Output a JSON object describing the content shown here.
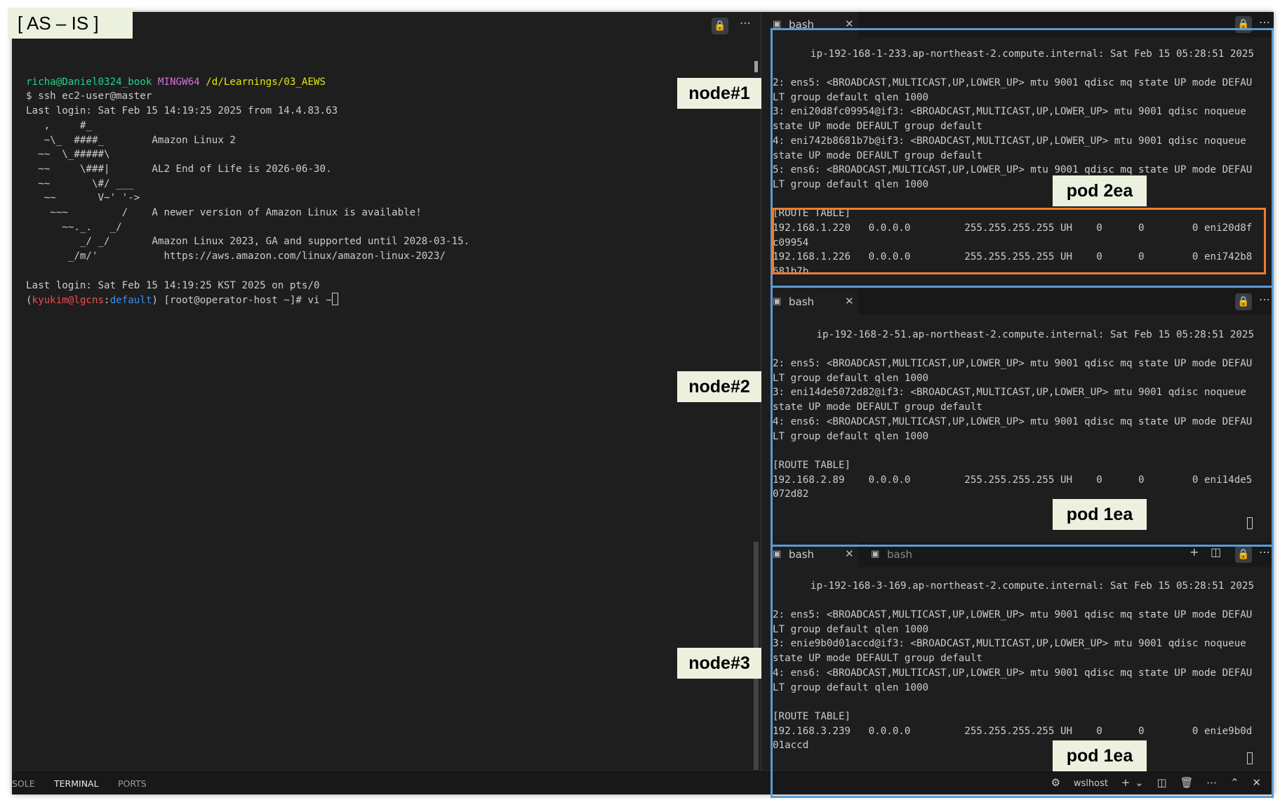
{
  "annotation": {
    "as_is_label": "[ AS – IS ]",
    "node1_label": "node#1",
    "node2_label": "node#2",
    "node3_label": "node#3",
    "pod_node1": "pod 2ea",
    "pod_node2": "pod 1ea",
    "pod_node3": "pod 1ea"
  },
  "left_terminal": {
    "prompt_user": "richa@Daniel0324_book",
    "prompt_env": "MINGW64",
    "prompt_path": "/d/Learnings/03_AEWS",
    "cmd_line": "$ ssh ec2-user@master",
    "last_login_1": "Last login: Sat Feb 15 14:19:25 2025 from 14.4.83.63",
    "banner": [
      "   ,     #_",
      "   ~\\_  ####_        Amazon Linux 2",
      "  ~~  \\_#####\\",
      "  ~~     \\###|       AL2 End of Life is 2026-06-30.",
      "  ~~       \\#/ ___",
      "   ~~       V~' '->",
      "    ~~~         /    A newer version of Amazon Linux is available!",
      "      ~~._.   _/",
      "         _/ _/       Amazon Linux 2023, GA and supported until 2028-03-15.",
      "       _/m/'           https://aws.amazon.com/linux/amazon-linux-2023/"
    ],
    "last_login_2": "Last login: Sat Feb 15 14:19:25 KST 2025 on pts/0",
    "ps1_open": "(",
    "ps1_user": "kyukim@lgcns",
    "ps1_colon": ":",
    "ps1_ctx": "default",
    "ps1_rest": ") [root@operator-host ~]# vi ~"
  },
  "pane1": {
    "tab_label": "bash",
    "header": "ip-192-168-1-233.ap-northeast-2.compute.internal: Sat Feb 15 05:28:51 2025",
    "lines": [
      "2: ens5: <BROADCAST,MULTICAST,UP,LOWER_UP> mtu 9001 qdisc mq state UP mode DEFAU",
      "LT group default qlen 1000",
      "3: eni20d8fc09954@if3: <BROADCAST,MULTICAST,UP,LOWER_UP> mtu 9001 qdisc noqueue",
      "state UP mode DEFAULT group default",
      "4: eni742b8681b7b@if3: <BROADCAST,MULTICAST,UP,LOWER_UP> mtu 9001 qdisc noqueue",
      "state UP mode DEFAULT group default",
      "5: ens6: <BROADCAST,MULTICAST,UP,LOWER_UP> mtu 9001 qdisc mq state UP mode DEFAU",
      "LT group default qlen 1000",
      "",
      "[ROUTE TABLE]",
      "192.168.1.220   0.0.0.0         255.255.255.255 UH    0      0        0 eni20d8f",
      "c09954",
      "192.168.1.226   0.0.0.0         255.255.255.255 UH    0      0        0 eni742b8",
      "681b7b"
    ]
  },
  "pane2": {
    "tab_label": "bash",
    "header": "ip-192-168-2-51.ap-northeast-2.compute.internal: Sat Feb 15 05:28:51 2025",
    "lines": [
      "2: ens5: <BROADCAST,MULTICAST,UP,LOWER_UP> mtu 9001 qdisc mq state UP mode DEFAU",
      "LT group default qlen 1000",
      "3: eni14de5072d82@if3: <BROADCAST,MULTICAST,UP,LOWER_UP> mtu 9001 qdisc noqueue",
      "state UP mode DEFAULT group default",
      "4: ens6: <BROADCAST,MULTICAST,UP,LOWER_UP> mtu 9001 qdisc mq state UP mode DEFAU",
      "LT group default qlen 1000",
      "",
      "[ROUTE TABLE]",
      "192.168.2.89    0.0.0.0         255.255.255.255 UH    0      0        0 eni14de5",
      "072d82"
    ]
  },
  "pane3": {
    "tab_label": "bash",
    "tab2_label": "bash",
    "header": "ip-192-168-3-169.ap-northeast-2.compute.internal: Sat Feb 15 05:28:51 2025",
    "lines": [
      "2: ens5: <BROADCAST,MULTICAST,UP,LOWER_UP> mtu 9001 qdisc mq state UP mode DEFAU",
      "LT group default qlen 1000",
      "3: enie9b0d01accd@if3: <BROADCAST,MULTICAST,UP,LOWER_UP> mtu 9001 qdisc noqueue",
      "state UP mode DEFAULT group default",
      "4: ens6: <BROADCAST,MULTICAST,UP,LOWER_UP> mtu 9001 qdisc mq state UP mode DEFAU",
      "LT group default qlen 1000",
      "",
      "[ROUTE TABLE]",
      "192.168.3.239   0.0.0.0         255.255.255.255 UH    0      0        0 enie9b0d",
      "01accd"
    ]
  },
  "panel": {
    "tab_console": "SOLE",
    "tab_terminal": "TERMINAL",
    "tab_ports": "PORTS",
    "shell": "wslhost"
  },
  "icons": {
    "lock": "lock-icon",
    "more": "ellipsis-icon",
    "terminal": "terminal-icon",
    "close": "close-icon",
    "plus": "plus-icon",
    "split": "split-icon",
    "trash": "trash-icon",
    "chevron_up": "chevron-up-icon",
    "chevron_down": "chevron-down-icon"
  },
  "colors": {
    "terminal_bg": "#1e1e1e",
    "callout_bg": "#ebf1de",
    "blue_box": "#5b9bd5",
    "orange_box": "#ed7d31"
  }
}
